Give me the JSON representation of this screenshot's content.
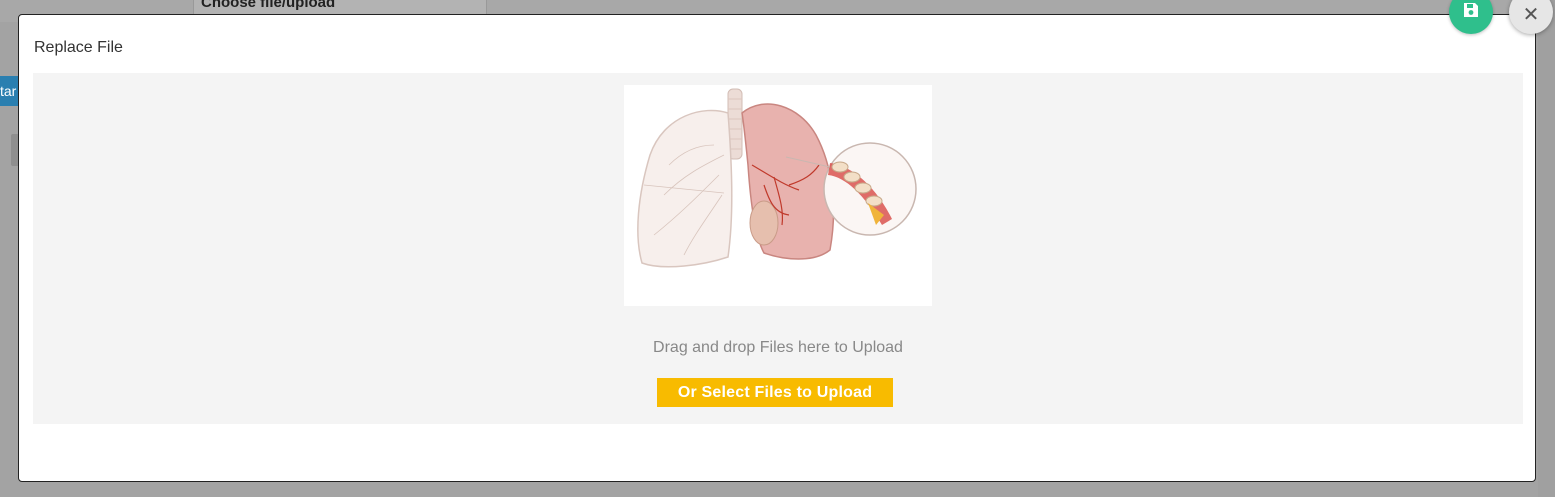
{
  "background": {
    "header_cell_text": "Choose file/upload",
    "tab_text": "tar"
  },
  "modal": {
    "title": "Replace File",
    "dropzone": {
      "preview_alt": "lungs-illustration",
      "instruction": "Drag and drop Files here to Upload",
      "select_button_label": "Or Select Files to Upload"
    }
  },
  "actions": {
    "save_icon": "floppy-disk-icon",
    "close_icon": "close-icon",
    "close_glyph": "✕"
  },
  "colors": {
    "save_button": "#2fbf8c",
    "select_button": "#f8bb00",
    "dropzone_bg": "#f4f4f4"
  }
}
